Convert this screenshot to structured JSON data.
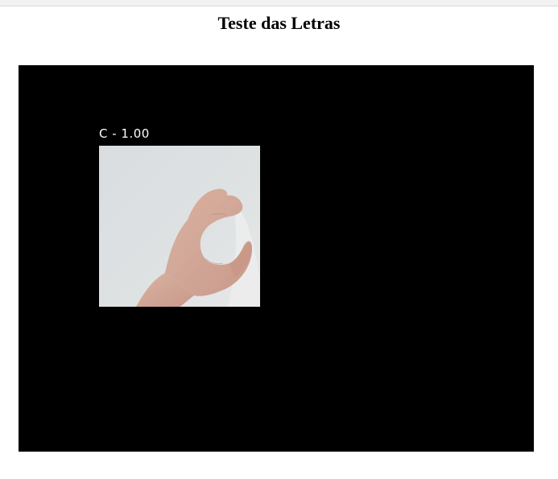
{
  "page": {
    "title": "Teste das Letras"
  },
  "detection": {
    "letter": "C",
    "confidence": "1.00",
    "label": "C - 1.00"
  },
  "crop": {
    "image": "hand-sign-c-image"
  },
  "colors": {
    "frame_background": "#000000",
    "label_text": "#ffffff",
    "page_background": "#ffffff"
  }
}
